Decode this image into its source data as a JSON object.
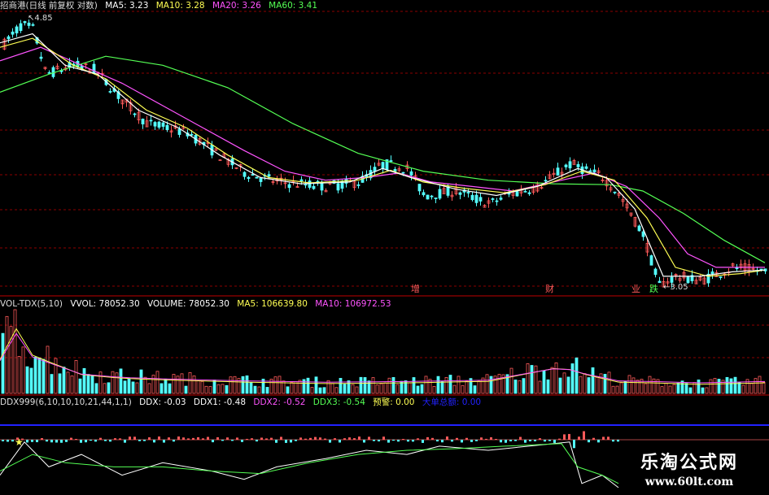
{
  "header_main": {
    "title": "招商港(日线 前复权 对数)",
    "ma5": "MA5: 3.23",
    "ma10": "MA10: 3.28",
    "ma20": "MA20: 3.26",
    "ma60": "MA60: 3.41"
  },
  "header_vol": {
    "title": "VOL-TDX(5,10)",
    "vvol": "VVOL: 78052.30",
    "volume": "VOLUME: 78052.30",
    "ma5": "MA5: 106639.80",
    "ma10": "MA10: 106972.53"
  },
  "header_ddx": {
    "title": "DDX999(6,10,10,10,21,44,1,1)",
    "ddx": "DDX: -0.03",
    "ddx1": "DDX1: -0.48",
    "ddx2": "DDX2: -0.52",
    "ddx3": "DDX3: -0.54",
    "alert": "预警: 0.00",
    "extra": "大单总额: 0.00"
  },
  "colors": {
    "up": "#ff5a5a",
    "down": "#54ffff",
    "ma5": "#ffffff",
    "ma10": "#ffff54",
    "ma20": "#ff54ff",
    "ma60": "#54ff54",
    "grid": "#8b0000",
    "ddx_line": "#2222ff"
  },
  "markers": [
    {
      "text": "增",
      "color": "#ff5a5a"
    },
    {
      "text": "财",
      "color": "#ff5a5a"
    },
    {
      "text": "业",
      "color": "#ff5a5a"
    },
    {
      "text": "跌",
      "color": "#54ff54"
    }
  ],
  "watermark": {
    "line1": "乐淘公式网",
    "line2": "www.60lt.com"
  },
  "chart_data": {
    "type": "line",
    "price_anchors": [
      [
        0,
        4.5
      ],
      [
        25,
        4.75
      ],
      [
        40,
        4.7
      ],
      [
        55,
        4.2
      ],
      [
        90,
        4.3
      ],
      [
        115,
        4.25
      ],
      [
        145,
        3.95
      ],
      [
        180,
        3.65
      ],
      [
        230,
        3.55
      ],
      [
        260,
        3.35
      ],
      [
        300,
        3.1
      ],
      [
        340,
        3.0
      ],
      [
        400,
        2.95
      ],
      [
        440,
        3.0
      ],
      [
        470,
        3.2
      ],
      [
        500,
        3.15
      ],
      [
        520,
        2.85
      ],
      [
        560,
        2.9
      ],
      [
        600,
        2.75
      ],
      [
        620,
        2.85
      ],
      [
        660,
        2.95
      ],
      [
        700,
        3.2
      ],
      [
        740,
        3.05
      ],
      [
        760,
        2.85
      ],
      [
        790,
        2.4
      ],
      [
        808,
        1.85
      ],
      [
        830,
        1.95
      ],
      [
        860,
        1.9
      ],
      [
        900,
        2.05
      ],
      [
        940,
        2.0
      ]
    ],
    "ma5_line": [
      [
        0,
        4.55
      ],
      [
        40,
        4.65
      ],
      [
        80,
        4.3
      ],
      [
        120,
        4.2
      ],
      [
        170,
        3.8
      ],
      [
        220,
        3.6
      ],
      [
        270,
        3.3
      ],
      [
        320,
        3.05
      ],
      [
        370,
        2.98
      ],
      [
        430,
        3.0
      ],
      [
        470,
        3.15
      ],
      [
        505,
        3.05
      ],
      [
        560,
        2.92
      ],
      [
        610,
        2.85
      ],
      [
        660,
        2.95
      ],
      [
        710,
        3.15
      ],
      [
        745,
        3.05
      ],
      [
        780,
        2.7
      ],
      [
        815,
        1.95
      ],
      [
        860,
        1.95
      ],
      [
        900,
        2.0
      ],
      [
        940,
        2.02
      ]
    ],
    "ma10_line": [
      [
        0,
        4.5
      ],
      [
        40,
        4.6
      ],
      [
        90,
        4.3
      ],
      [
        130,
        4.15
      ],
      [
        180,
        3.8
      ],
      [
        230,
        3.6
      ],
      [
        280,
        3.3
      ],
      [
        330,
        3.05
      ],
      [
        380,
        2.99
      ],
      [
        440,
        3.02
      ],
      [
        480,
        3.13
      ],
      [
        520,
        3.0
      ],
      [
        570,
        2.93
      ],
      [
        620,
        2.88
      ],
      [
        670,
        2.97
      ],
      [
        715,
        3.12
      ],
      [
        755,
        3.02
      ],
      [
        795,
        2.6
      ],
      [
        830,
        2.05
      ],
      [
        870,
        1.95
      ],
      [
        910,
        1.98
      ],
      [
        940,
        2.02
      ]
    ],
    "ma20_line": [
      [
        0,
        4.35
      ],
      [
        50,
        4.5
      ],
      [
        100,
        4.3
      ],
      [
        150,
        4.1
      ],
      [
        200,
        3.85
      ],
      [
        250,
        3.6
      ],
      [
        300,
        3.35
      ],
      [
        350,
        3.12
      ],
      [
        400,
        3.02
      ],
      [
        450,
        3.05
      ],
      [
        490,
        3.1
      ],
      [
        530,
        3.0
      ],
      [
        580,
        2.95
      ],
      [
        630,
        2.9
      ],
      [
        680,
        3.0
      ],
      [
        730,
        3.1
      ],
      [
        770,
        2.95
      ],
      [
        810,
        2.6
      ],
      [
        845,
        2.2
      ],
      [
        880,
        2.05
      ],
      [
        940,
        2.05
      ]
    ],
    "ma60_line": [
      [
        0,
        4.0
      ],
      [
        60,
        4.2
      ],
      [
        130,
        4.4
      ],
      [
        200,
        4.3
      ],
      [
        280,
        4.05
      ],
      [
        360,
        3.65
      ],
      [
        440,
        3.32
      ],
      [
        520,
        3.12
      ],
      [
        600,
        3.02
      ],
      [
        680,
        2.98
      ],
      [
        750,
        2.97
      ],
      [
        790,
        2.9
      ],
      [
        840,
        2.65
      ],
      [
        890,
        2.35
      ],
      [
        940,
        2.1
      ]
    ],
    "price_labels": [
      "4.85",
      "3.05"
    ],
    "volume_anchors": [
      [
        0,
        0.45
      ],
      [
        18,
        0.92
      ],
      [
        30,
        0.55
      ],
      [
        60,
        0.42
      ],
      [
        100,
        0.25
      ],
      [
        150,
        0.2
      ],
      [
        200,
        0.18
      ],
      [
        300,
        0.15
      ],
      [
        400,
        0.13
      ],
      [
        500,
        0.14
      ],
      [
        600,
        0.16
      ],
      [
        690,
        0.35
      ],
      [
        720,
        0.25
      ],
      [
        760,
        0.15
      ],
      [
        800,
        0.14
      ],
      [
        860,
        0.12
      ],
      [
        940,
        0.14
      ]
    ],
    "ddx_level": 0,
    "ddx_line1": [
      [
        0,
        0.2
      ],
      [
        30,
        0.6
      ],
      [
        60,
        0.3
      ],
      [
        100,
        0.45
      ],
      [
        150,
        0.2
      ],
      [
        200,
        0.35
      ],
      [
        260,
        0.25
      ],
      [
        300,
        0.15
      ],
      [
        340,
        0.3
      ],
      [
        400,
        0.4
      ],
      [
        450,
        0.5
      ],
      [
        500,
        0.45
      ],
      [
        540,
        0.55
      ],
      [
        600,
        0.5
      ],
      [
        650,
        0.55
      ],
      [
        700,
        0.6
      ],
      [
        715,
        0.1
      ],
      [
        740,
        0.2
      ],
      [
        760,
        0.05
      ]
    ],
    "ddx_line2": [
      [
        0,
        0.25
      ],
      [
        40,
        0.45
      ],
      [
        80,
        0.35
      ],
      [
        140,
        0.3
      ],
      [
        200,
        0.3
      ],
      [
        260,
        0.25
      ],
      [
        320,
        0.22
      ],
      [
        380,
        0.35
      ],
      [
        440,
        0.45
      ],
      [
        500,
        0.5
      ],
      [
        560,
        0.52
      ],
      [
        620,
        0.55
      ],
      [
        690,
        0.58
      ],
      [
        710,
        0.3
      ],
      [
        740,
        0.2
      ],
      [
        760,
        0.1
      ]
    ]
  }
}
